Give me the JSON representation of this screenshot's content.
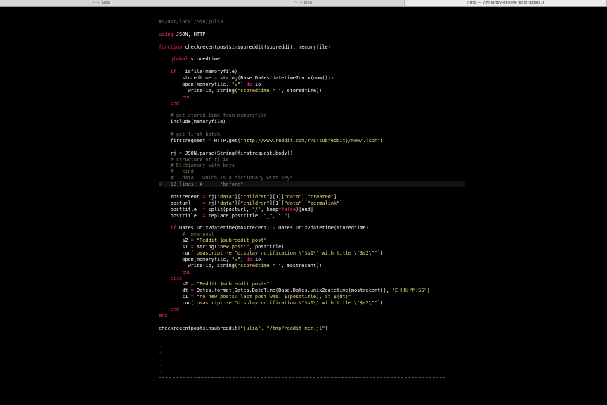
{
  "tabs": [
    {
      "label": "~ — julia",
      "active": false
    },
    {
      "label": "~ — julia",
      "active": false
    },
    {
      "label": "/tmp — vim notify-of-new-reddit-posts.jl",
      "active": true
    }
  ],
  "colors": {
    "background": "#000000",
    "text": "#f8f8f2",
    "keyword": "#f92672",
    "string": "#e6db74",
    "comment": "#75715e"
  },
  "lines": [
    [
      {
        "t": "#!/usr/local/bin/julia",
        "k": "cmt"
      }
    ],
    [],
    [
      {
        "t": "using",
        "k": "key"
      },
      {
        "t": " JSON, HTTP",
        "k": "def"
      }
    ],
    [],
    [
      {
        "t": "function",
        "k": "key"
      },
      {
        "t": " checkrecentpostsinsubreddit(subreddit, memoryfile)",
        "k": "def"
      }
    ],
    [],
    [
      {
        "t": "    global",
        "k": "key"
      },
      {
        "t": " storedtime",
        "k": "def"
      }
    ],
    [],
    [
      {
        "t": "    if",
        "k": "key"
      },
      {
        "t": " ",
        "k": "def"
      },
      {
        "t": "!",
        "k": "key"
      },
      {
        "t": " isfile(memoryfile)",
        "k": "def"
      }
    ],
    [
      {
        "t": "        storedtime ",
        "k": "def"
      },
      {
        "t": "=",
        "k": "key"
      },
      {
        "t": " string(Base.Dates.datetime2unix(now()))",
        "k": "def"
      }
    ],
    [
      {
        "t": "        open(memoryfile, ",
        "k": "def"
      },
      {
        "t": "\"w\"",
        "k": "str"
      },
      {
        "t": ") ",
        "k": "def"
      },
      {
        "t": "do",
        "k": "key"
      },
      {
        "t": " io",
        "k": "def"
      }
    ],
    [
      {
        "t": "          write(io, string(",
        "k": "def"
      },
      {
        "t": "\"storedtime = \"",
        "k": "str"
      },
      {
        "t": ", storedtime))",
        "k": "def"
      }
    ],
    [
      {
        "t": "        end",
        "k": "key"
      }
    ],
    [
      {
        "t": "    end",
        "k": "key"
      }
    ],
    [],
    [
      {
        "t": "    # get stored time from memoryfile",
        "k": "cmt"
      }
    ],
    [
      {
        "t": "    include(memoryfile)",
        "k": "def"
      }
    ],
    [],
    [
      {
        "t": "    # get first batch",
        "k": "cmt"
      }
    ],
    [
      {
        "t": "    firstrequest ",
        "k": "def"
      },
      {
        "t": "=",
        "k": "key"
      },
      {
        "t": " HTTP.get(",
        "k": "def"
      },
      {
        "t": "\"http://www.reddit.com/r/$(subreddit)/new/.json\"",
        "k": "str"
      },
      {
        "t": ")",
        "k": "def"
      }
    ],
    [],
    [
      {
        "t": "    rj ",
        "k": "def"
      },
      {
        "t": "=",
        "k": "key"
      },
      {
        "t": " JSON.parse(String(firstrequest.body))",
        "k": "def"
      }
    ],
    [
      {
        "t": "    # structure of rj is",
        "k": "cmt"
      }
    ],
    [
      {
        "t": "    # Dictionary with keys",
        "k": "cmt"
      }
    ],
    [
      {
        "t": "    #   kind",
        "k": "cmt"
      }
    ],
    [
      {
        "t": "    #   data   which is a dictionary with keys",
        "k": "cmt"
      }
    ],
    [
      {
        "t": "+-- 12 lines: #      \"before\"----------------------------------------------------------------------------",
        "k": "fold"
      }
    ],
    [],
    [
      {
        "t": "    mostrecent ",
        "k": "def"
      },
      {
        "t": "=",
        "k": "key"
      },
      {
        "t": " rj[",
        "k": "def"
      },
      {
        "t": "\"data\"",
        "k": "str"
      },
      {
        "t": "][",
        "k": "def"
      },
      {
        "t": "\"children\"",
        "k": "str"
      },
      {
        "t": "][1][",
        "k": "def"
      },
      {
        "t": "\"data\"",
        "k": "str"
      },
      {
        "t": "][",
        "k": "def"
      },
      {
        "t": "\"created\"",
        "k": "str"
      },
      {
        "t": "]",
        "k": "def"
      }
    ],
    [
      {
        "t": "    posturl    ",
        "k": "def"
      },
      {
        "t": "=",
        "k": "key"
      },
      {
        "t": " rj[",
        "k": "def"
      },
      {
        "t": "\"data\"",
        "k": "str"
      },
      {
        "t": "][",
        "k": "def"
      },
      {
        "t": "\"children\"",
        "k": "str"
      },
      {
        "t": "][1][",
        "k": "def"
      },
      {
        "t": "\"data\"",
        "k": "str"
      },
      {
        "t": "][",
        "k": "def"
      },
      {
        "t": "\"permalink\"",
        "k": "str"
      },
      {
        "t": "]",
        "k": "def"
      }
    ],
    [
      {
        "t": "    posttitle  ",
        "k": "def"
      },
      {
        "t": "=",
        "k": "key"
      },
      {
        "t": " split(posturl, ",
        "k": "def"
      },
      {
        "t": "\"/\"",
        "k": "str"
      },
      {
        "t": ", keep",
        "k": "def"
      },
      {
        "t": "=",
        "k": "key"
      },
      {
        "t": "false",
        "k": "key"
      },
      {
        "t": ")[end]",
        "k": "def"
      }
    ],
    [
      {
        "t": "    posttitle  ",
        "k": "def"
      },
      {
        "t": "=",
        "k": "key"
      },
      {
        "t": " replace(posttitle, ",
        "k": "def"
      },
      {
        "t": "\"_\"",
        "k": "str"
      },
      {
        "t": ", ",
        "k": "def"
      },
      {
        "t": "\" \"",
        "k": "str"
      },
      {
        "t": ")",
        "k": "def"
      }
    ],
    [],
    [
      {
        "t": "    if",
        "k": "key"
      },
      {
        "t": " Dates.unix2datetime(mostrecent) ",
        "k": "def"
      },
      {
        "t": ">",
        "k": "key"
      },
      {
        "t": " Dates.unix2datetime(storedtime)",
        "k": "def"
      }
    ],
    [
      {
        "t": "        #  new post",
        "k": "cmt"
      }
    ],
    [
      {
        "t": "        s2 ",
        "k": "def"
      },
      {
        "t": "=",
        "k": "key"
      },
      {
        "t": " ",
        "k": "def"
      },
      {
        "t": "\"Reddit $subreddit post\"",
        "k": "str"
      }
    ],
    [
      {
        "t": "        s1 ",
        "k": "def"
      },
      {
        "t": "=",
        "k": "key"
      },
      {
        "t": " string(",
        "k": "def"
      },
      {
        "t": "\"new post:\"",
        "k": "str"
      },
      {
        "t": ", posttitle)",
        "k": "def"
      }
    ],
    [
      {
        "t": "        run(",
        "k": "def"
      },
      {
        "t": "`osascript -e \"display notification \\\"$s1\\\" with title \\\"$s2\\\"\"`",
        "k": "str"
      },
      {
        "t": ")",
        "k": "def"
      }
    ],
    [
      {
        "t": "        open(memoryfile, ",
        "k": "def"
      },
      {
        "t": "\"w\"",
        "k": "str"
      },
      {
        "t": ") ",
        "k": "def"
      },
      {
        "t": "do",
        "k": "key"
      },
      {
        "t": " io",
        "k": "def"
      }
    ],
    [
      {
        "t": "          write(io, string(",
        "k": "def"
      },
      {
        "t": "\"storedtime = \"",
        "k": "str"
      },
      {
        "t": ", mostrecent))",
        "k": "def"
      }
    ],
    [
      {
        "t": "        end",
        "k": "key"
      }
    ],
    [
      {
        "t": "    else",
        "k": "key"
      }
    ],
    [
      {
        "t": "        s2 ",
        "k": "def"
      },
      {
        "t": "=",
        "k": "key"
      },
      {
        "t": " ",
        "k": "def"
      },
      {
        "t": "\"Reddit $subreddit posts\"",
        "k": "str"
      }
    ],
    [
      {
        "t": "        dt ",
        "k": "def"
      },
      {
        "t": "=",
        "k": "key"
      },
      {
        "t": " Dates.format(Dates.DateTime(Base.Dates.unix2datetime(mostrecent)), ",
        "k": "def"
      },
      {
        "t": "\"E HH:MM:SS\"",
        "k": "str"
      },
      {
        "t": ")",
        "k": "def"
      }
    ],
    [
      {
        "t": "        s1 ",
        "k": "def"
      },
      {
        "t": "=",
        "k": "key"
      },
      {
        "t": " ",
        "k": "def"
      },
      {
        "t": "\"no new posts: last post was: $(posttitle), at $(dt)\"",
        "k": "str"
      }
    ],
    [
      {
        "t": "        run(",
        "k": "def"
      },
      {
        "t": "`osascript -e \"display notification \\\"$s1\\\" with title \\\"$s2\\\"\"`",
        "k": "str"
      },
      {
        "t": ")",
        "k": "def"
      }
    ],
    [
      {
        "t": "    end",
        "k": "key"
      }
    ],
    [
      {
        "t": "end",
        "k": "key"
      }
    ],
    [],
    [
      {
        "t": "checkrecentpostsinsubreddit(",
        "k": "def"
      },
      {
        "t": "\"julia\"",
        "k": "str"
      },
      {
        "t": ", ",
        "k": "def"
      },
      {
        "t": "\"/tmp/reddit-mem.jl\"",
        "k": "str"
      },
      {
        "t": ")",
        "k": "def"
      }
    ],
    [],
    [
      {
        "t": "~",
        "k": "tilde"
      }
    ],
    [
      {
        "t": "~",
        "k": "tilde"
      }
    ],
    [
      {
        "t": "~",
        "k": "tilde"
      }
    ],
    [
      {
        "t": "~",
        "k": "tilde"
      }
    ],
    [
      {
        "t": "~",
        "k": "tilde"
      }
    ],
    [
      {
        "t": "~",
        "k": "tilde"
      }
    ]
  ]
}
